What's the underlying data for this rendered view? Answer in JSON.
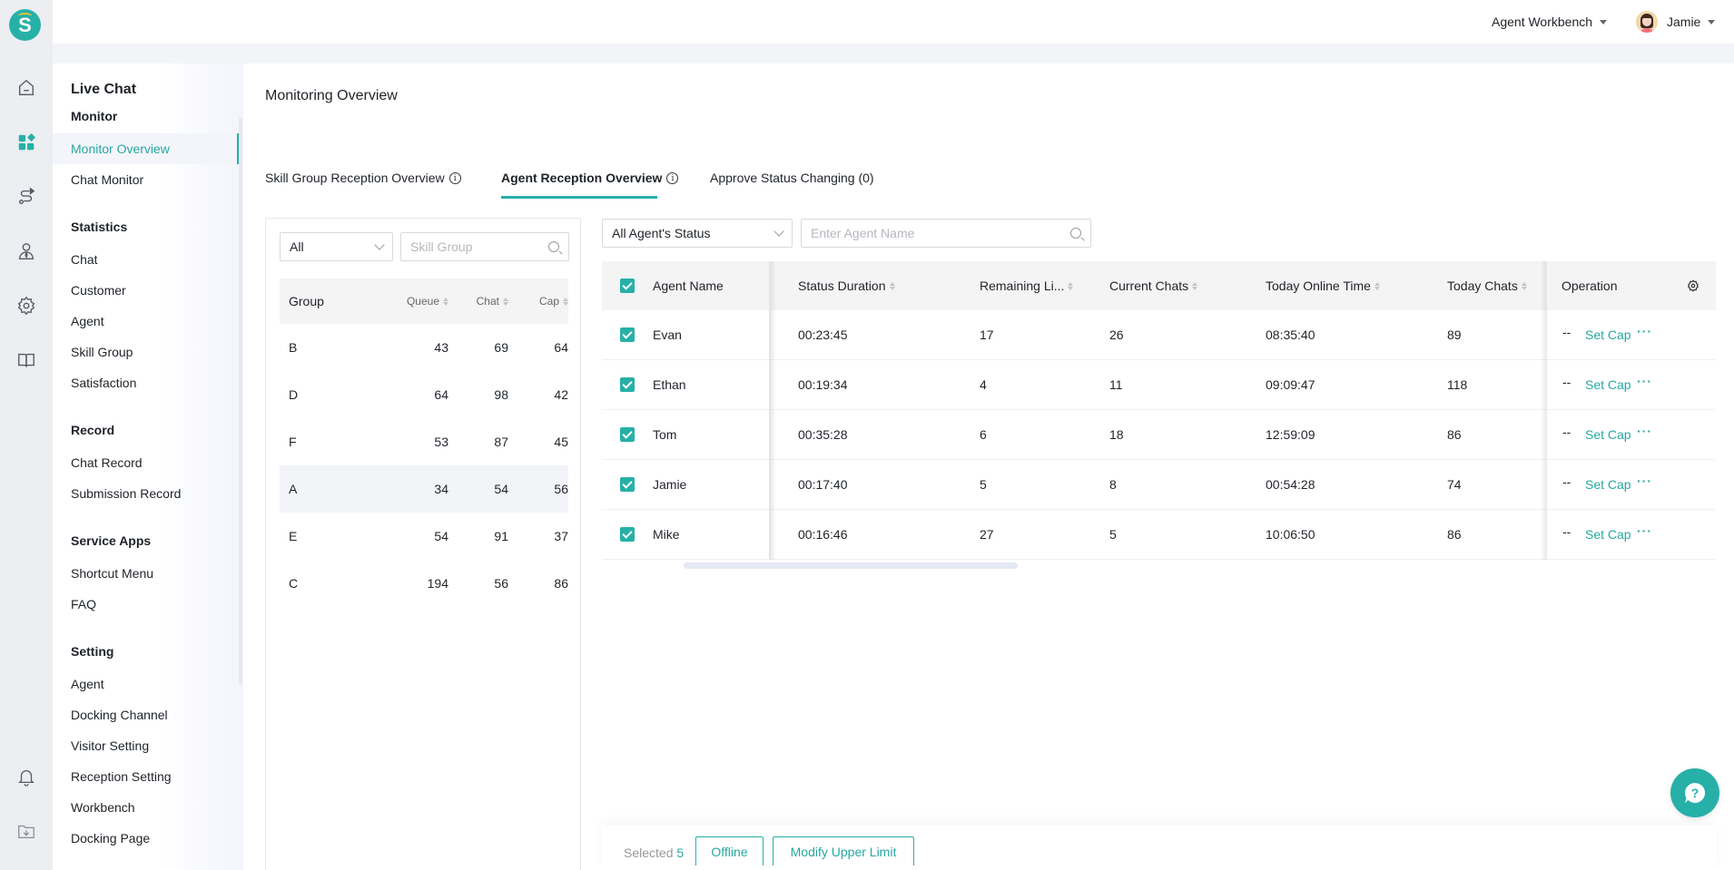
{
  "app": {
    "logo_letter": "S",
    "rail_icons": [
      "home-icon",
      "apps-grid-icon",
      "routing-icon",
      "agent-icon",
      "settings-icon",
      "book-icon",
      "bell-icon",
      "download-folder-icon"
    ],
    "accent_color": "#27b0a8"
  },
  "topbar": {
    "workbench_label": "Agent Workbench",
    "user_name": "Jamie"
  },
  "sidebar": {
    "title": "Live Chat",
    "groups": [
      {
        "label": "Monitor",
        "items": [
          {
            "label": "Monitor Overview",
            "active": true
          },
          {
            "label": "Chat Monitor"
          }
        ]
      },
      {
        "label": "Statistics",
        "items": [
          {
            "label": "Chat"
          },
          {
            "label": "Customer"
          },
          {
            "label": "Agent"
          },
          {
            "label": "Skill Group"
          },
          {
            "label": "Satisfaction"
          }
        ]
      },
      {
        "label": "Record",
        "items": [
          {
            "label": "Chat Record"
          },
          {
            "label": "Submission Record"
          }
        ]
      },
      {
        "label": "Service Apps",
        "items": [
          {
            "label": "Shortcut Menu"
          },
          {
            "label": "FAQ"
          }
        ]
      },
      {
        "label": "Setting",
        "items": [
          {
            "label": "Agent"
          },
          {
            "label": "Docking Channel"
          },
          {
            "label": "Visitor Setting"
          },
          {
            "label": "Reception Setting"
          },
          {
            "label": "Workbench"
          },
          {
            "label": "Docking Page"
          }
        ]
      }
    ]
  },
  "main": {
    "title": "Monitoring Overview",
    "tabs": [
      {
        "label": "Skill Group Reception Overview",
        "has_info": true
      },
      {
        "label": "Agent Reception Overview",
        "has_info": true,
        "active": true
      },
      {
        "label": "Approve Status Changing (0)",
        "has_info": false
      }
    ]
  },
  "group_panel": {
    "filter_value": "All",
    "search_placeholder": "Skill Group",
    "columns": [
      "Group",
      "Queue",
      "Chat",
      "Cap"
    ],
    "rows": [
      {
        "group": "B",
        "queue": "43",
        "chat": "69",
        "cap": "64"
      },
      {
        "group": "D",
        "queue": "64",
        "chat": "98",
        "cap": "42"
      },
      {
        "group": "F",
        "queue": "53",
        "chat": "87",
        "cap": "45"
      },
      {
        "group": "A",
        "queue": "34",
        "chat": "54",
        "cap": "56",
        "highlighted": true
      },
      {
        "group": "E",
        "queue": "54",
        "chat": "91",
        "cap": "37"
      },
      {
        "group": "C",
        "queue": "194",
        "chat": "56",
        "cap": "86"
      }
    ]
  },
  "agent_panel": {
    "status_filter": "All Agent's Status",
    "search_placeholder": "Enter Agent Name",
    "columns": {
      "name": "Agent Name",
      "status_duration": "Status Duration",
      "remaining": "Remaining Li...",
      "current_chats": "Current Chats",
      "online_time": "Today Online Time",
      "today_chats": "Today Chats",
      "operation": "Operation"
    },
    "rows": [
      {
        "name": "Evan",
        "status_duration": "00:23:45",
        "remaining": "17",
        "current_chats": "26",
        "online_time": "08:35:40",
        "today_chats": "89",
        "cap": "--",
        "action": "Set Cap",
        "checked": true
      },
      {
        "name": "Ethan",
        "status_duration": "00:19:34",
        "remaining": "4",
        "current_chats": "11",
        "online_time": "09:09:47",
        "today_chats": "118",
        "cap": "--",
        "action": "Set Cap",
        "checked": true
      },
      {
        "name": "Tom",
        "status_duration": "00:35:28",
        "remaining": "6",
        "current_chats": "18",
        "online_time": "12:59:09",
        "today_chats": "86",
        "cap": "--",
        "action": "Set Cap",
        "checked": true
      },
      {
        "name": "Jamie",
        "status_duration": "00:17:40",
        "remaining": "5",
        "current_chats": "8",
        "online_time": "00:54:28",
        "today_chats": "74",
        "cap": "--",
        "action": "Set Cap",
        "checked": true
      },
      {
        "name": "Mike",
        "status_duration": "00:16:46",
        "remaining": "27",
        "current_chats": "5",
        "online_time": "10:06:50",
        "today_chats": "86",
        "cap": "--",
        "action": "Set Cap",
        "checked": true
      }
    ],
    "more_label": "···"
  },
  "bottom_bar": {
    "selected_label": "Selected",
    "selected_count": "5",
    "offline_label": "Offline",
    "modify_label": "Modify Upper Limit"
  }
}
